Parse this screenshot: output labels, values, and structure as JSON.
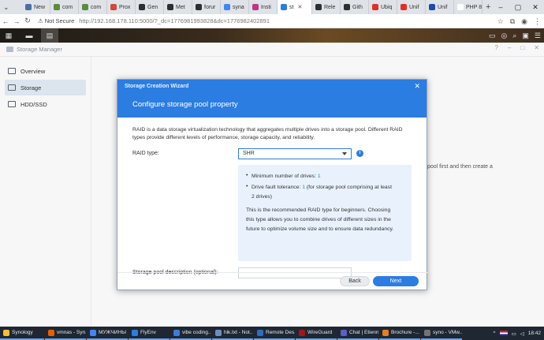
{
  "browser": {
    "tabs": [
      {
        "label": "New",
        "color": "#4a6fa5"
      },
      {
        "label": "com",
        "color": "#5b8c3a"
      },
      {
        "label": "com",
        "color": "#5b8c3a"
      },
      {
        "label": "Prox",
        "color": "#d44638"
      },
      {
        "label": "Gen",
        "color": "#2f2f2f"
      },
      {
        "label": "Met",
        "color": "#2f2f2f"
      },
      {
        "label": "forur",
        "color": "#2f2f2f"
      },
      {
        "label": "syna",
        "color": "#4285f4"
      },
      {
        "label": "Insti",
        "color": "#c13584"
      },
      {
        "label": "st",
        "color": "#2b7de1",
        "active": true
      },
      {
        "label": "Rele",
        "color": "#2f2f2f"
      },
      {
        "label": "Gith",
        "color": "#2f2f2f"
      },
      {
        "label": "Ubiq",
        "color": "#e52d27"
      },
      {
        "label": "Unif",
        "color": "#e52d27"
      },
      {
        "label": "Unif",
        "color": "#1f4aa8"
      },
      {
        "label": "PHP 8.5",
        "color": "#ffffff"
      }
    ],
    "security_label": "Not Secure",
    "url": "http://192.168.178.110:5000/?_dc=1776981993828&dc=1776982402891"
  },
  "storage_manager": {
    "title": "Storage Manager",
    "sidebar": [
      {
        "label": "Overview"
      },
      {
        "label": "Storage",
        "active": true
      },
      {
        "label": "HDD/SSD"
      }
    ],
    "background_hint": "pool first and then create a"
  },
  "wizard": {
    "window_title": "Storage Creation Wizard",
    "heading": "Configure storage pool property",
    "description": "RAID is a data storage virtualization technology that aggregates multiple drives into a storage pool. Different RAID types provide different levels of performance, storage capacity, and reliability.",
    "raid_type_label": "RAID type:",
    "raid_type_value": "SHR",
    "info_min_drives_label": "Minimum number of drives:",
    "info_min_drives_value": "1",
    "info_fault_label": "Drive fault tolerance:",
    "info_fault_value": "1",
    "info_fault_suffix_1": "(for storage pool comprising at least",
    "info_fault_suffix_2": "2 drives)",
    "info_para_1": "This is the recommended RAID type for beginners. Choosing",
    "info_para_2": "this type allows you to combine drives of different sizes in the",
    "info_para_3": "future to optimize volume size and to ensure data redundancy.",
    "pool_description_label": "Storage pool description (optional):",
    "pool_description_value": "",
    "back_label": "Back",
    "next_label": "Next"
  },
  "taskbar": {
    "items": [
      {
        "label": "Synology",
        "color": "#f2c230"
      },
      {
        "label": "vmnas - Syn...",
        "color": "#e66000"
      },
      {
        "label": "МУЖЧИНЫ ...",
        "color": "#4285f4"
      },
      {
        "label": "FlyEnv",
        "color": "#2b7de1"
      },
      {
        "label": "vibe coding...",
        "color": "#3b7ddd"
      },
      {
        "label": "hik.txt - Not...",
        "color": "#6c8ebf"
      },
      {
        "label": "Remote Des...",
        "color": "#2a6fc2"
      },
      {
        "label": "WireGuard",
        "color": "#a0181b"
      },
      {
        "label": "Chat | Etienn...",
        "color": "#5b5fc7"
      },
      {
        "label": "Brochure -...",
        "color": "#e67e22"
      },
      {
        "label": "syno - VMw...",
        "color": "#737373"
      }
    ],
    "time": "18:42"
  }
}
